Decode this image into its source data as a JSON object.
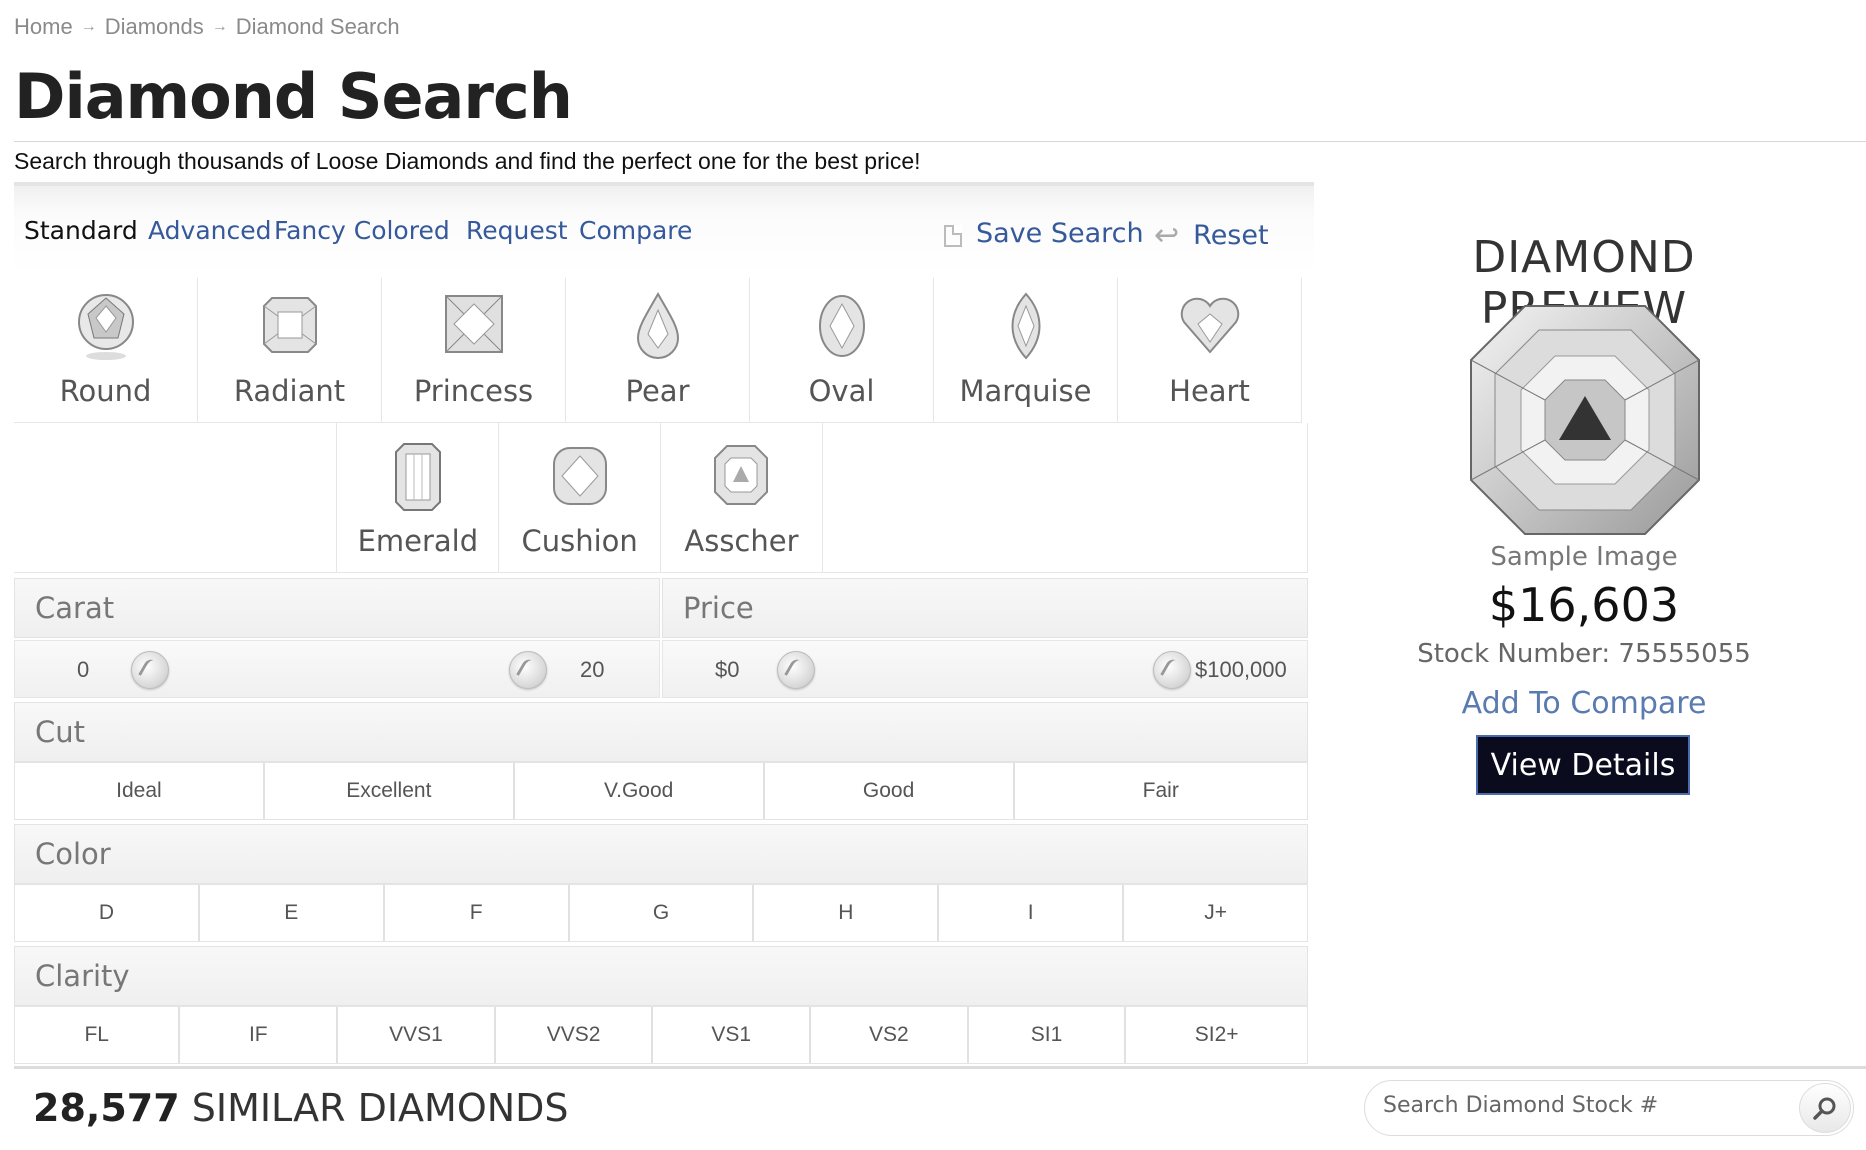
{
  "breadcrumb": {
    "items": [
      "Home",
      "Diamonds",
      "Diamond Search"
    ]
  },
  "page": {
    "title": "Diamond Search",
    "subtitle": "Search through thousands of Loose Diamonds and find the perfect one for the best price!"
  },
  "tabs": {
    "items": [
      "Standard",
      "Advanced",
      "Fancy Colored",
      "Request",
      "Compare"
    ],
    "active": "Standard",
    "save_label": "Save Search",
    "reset_label": "Reset"
  },
  "shapes": {
    "row1": [
      "Round",
      "Radiant",
      "Princess",
      "Pear",
      "Oval",
      "Marquise",
      "Heart"
    ],
    "row2": [
      "Emerald",
      "Cushion",
      "Asscher"
    ]
  },
  "carat": {
    "label": "Carat",
    "min": "0",
    "max": "20"
  },
  "price_filter": {
    "label": "Price",
    "min": "$0",
    "max": "$100,000"
  },
  "cut": {
    "label": "Cut",
    "options": [
      "Ideal",
      "Excellent",
      "V.Good",
      "Good",
      "Fair"
    ]
  },
  "color": {
    "label": "Color",
    "options": [
      "D",
      "E",
      "F",
      "G",
      "H",
      "I",
      "J+"
    ]
  },
  "clarity": {
    "label": "Clarity",
    "options": [
      "FL",
      "IF",
      "VVS1",
      "VVS2",
      "VS1",
      "VS2",
      "SI1",
      "SI2+"
    ]
  },
  "results": {
    "count": "28,577",
    "label": "SIMILAR DIAMONDS"
  },
  "stock_search": {
    "placeholder": "Search Diamond Stock #"
  },
  "preview": {
    "title": "DIAMOND PREVIEW",
    "sample_label": "Sample Image",
    "price": "$16,603",
    "stock_number": "Stock Number: 75555055",
    "add_to_compare": "Add To Compare",
    "view_details": "View Details"
  },
  "colors": {
    "link": "#35599a",
    "button_bg": "#0b0b1e",
    "button_border": "#4a6bb0"
  },
  "icons": {
    "save": "document-icon",
    "reset": "back-arrow-icon",
    "search": "magnifier-icon"
  }
}
